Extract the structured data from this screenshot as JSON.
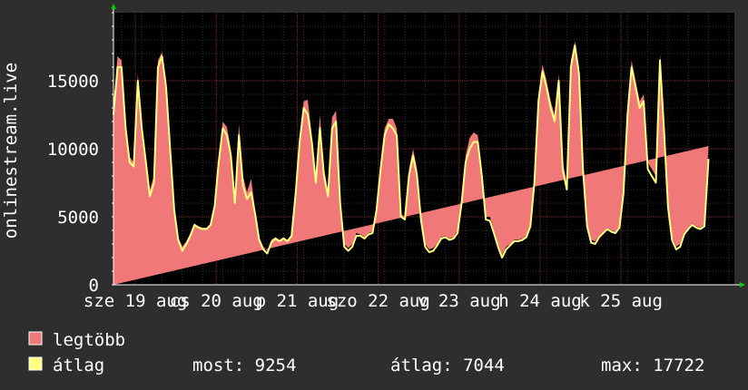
{
  "chart_data": {
    "type": "area",
    "ylabel": "onlinestream.live",
    "ylim": [
      0,
      20000
    ],
    "yticks": [
      {
        "value": 0,
        "label": "0"
      },
      {
        "value": 5000,
        "label": "5000"
      },
      {
        "value": 10000,
        "label": "10000"
      },
      {
        "value": 15000,
        "label": "15000"
      }
    ],
    "xlim": [
      0,
      7.67
    ],
    "xticks": [
      {
        "value": 0.27,
        "label": "sze 19 aug"
      },
      {
        "value": 1.27,
        "label": "cs 20 aug"
      },
      {
        "value": 2.27,
        "label": "p 21 aug"
      },
      {
        "value": 3.27,
        "label": "szo 22 aug"
      },
      {
        "value": 4.27,
        "label": "v 23 aug"
      },
      {
        "value": 5.27,
        "label": "h 24 aug"
      },
      {
        "value": 6.27,
        "label": "k 25 aug"
      }
    ],
    "grid": true,
    "colors": {
      "background": "#2e2e2e",
      "canvas": "#000000",
      "grid_minor": "#333333",
      "grid_major": "#8a2a2a",
      "max_fill": "#f07878",
      "avg_line": "#ffff80",
      "arrow": "#00cc00"
    },
    "x": [
      0,
      0.05,
      0.1,
      0.15,
      0.2,
      0.25,
      0.3,
      0.35,
      0.4,
      0.45,
      0.5,
      0.55,
      0.6,
      0.65,
      0.7,
      0.75,
      0.8,
      0.85,
      0.9,
      0.95,
      1.0,
      1.05,
      1.1,
      1.15,
      1.2,
      1.25,
      1.3,
      1.35,
      1.4,
      1.45,
      1.5,
      1.55,
      1.6,
      1.65,
      1.7,
      1.75,
      1.8,
      1.85,
      1.9,
      1.95,
      2.0,
      2.05,
      2.1,
      2.15,
      2.2,
      2.25,
      2.3,
      2.35,
      2.4,
      2.45,
      2.5,
      2.55,
      2.6,
      2.65,
      2.7,
      2.75,
      2.8,
      2.85,
      2.9,
      2.95,
      3.0,
      3.05,
      3.1,
      3.15,
      3.2,
      3.25,
      3.3,
      3.35,
      3.4,
      3.45,
      3.5,
      3.55,
      3.6,
      3.65,
      3.7,
      3.75,
      3.8,
      3.85,
      3.9,
      3.95,
      4.0,
      4.05,
      4.1,
      4.15,
      4.2,
      4.25,
      4.3,
      4.35,
      4.4,
      4.45,
      4.5,
      4.55,
      4.6,
      4.65,
      4.7,
      4.75,
      4.8,
      4.85,
      4.9,
      4.95,
      5.0,
      5.05,
      5.1,
      5.15,
      5.2,
      5.25,
      5.3,
      5.35,
      5.4,
      5.45,
      5.5,
      5.55,
      5.6,
      5.65,
      5.7,
      5.75,
      5.8,
      5.85,
      5.9,
      5.95,
      6.0,
      6.05,
      6.1,
      6.15,
      6.2,
      6.25,
      6.3,
      6.35,
      6.4,
      6.45,
      6.5,
      6.55,
      6.6,
      6.65,
      6.7,
      6.75,
      6.8,
      6.85,
      6.9,
      6.95,
      7.0,
      7.05,
      7.1,
      7.15,
      7.2,
      7.25,
      7.3,
      7.35,
      7.4,
      7.45,
      7.5,
      7.55,
      7.6,
      7.65
    ],
    "series": [
      {
        "name": "legtöbb",
        "color": "#f07878",
        "values": [
          13200,
          16800,
          16500,
          12000,
          9400,
          9000,
          15500,
          12000,
          9500,
          7000,
          8000,
          16500,
          17100,
          15000,
          10500,
          5800,
          3500,
          2800,
          3200,
          3800,
          4500,
          4300,
          4200,
          4200,
          4500,
          6000,
          9500,
          12000,
          11600,
          10000,
          6500,
          11800,
          8000,
          6800,
          7800,
          5500,
          3500,
          2800,
          2500,
          3300,
          3500,
          3300,
          3500,
          3300,
          3700,
          7000,
          11000,
          13500,
          13600,
          11000,
          8000,
          12500,
          8500,
          7000,
          12300,
          12800,
          6500,
          3000,
          2700,
          3000,
          3800,
          3700,
          3500,
          3800,
          3900,
          5800,
          9000,
          11500,
          12200,
          12200,
          11500,
          5200,
          5000,
          8500,
          10000,
          8500,
          5000,
          3000,
          2600,
          2700,
          3000,
          3500,
          3600,
          3400,
          3500,
          4000,
          6500,
          9500,
          10800,
          11200,
          11000,
          8500,
          5000,
          5000,
          4000,
          3000,
          2200,
          2800,
          3000,
          3300,
          3300,
          3400,
          3600,
          4500,
          8000,
          14000,
          16200,
          15000,
          13500,
          12500,
          15500,
          9000,
          7500,
          16500,
          17900,
          16000,
          9000,
          4500,
          3300,
          3200,
          3600,
          3900,
          4200,
          4000,
          3900,
          4300,
          7000,
          13000,
          16500,
          15000,
          13500,
          14000,
          9000,
          8500,
          8000,
          17000,
          12000,
          6000,
          3500,
          2800,
          3000,
          3800,
          4200,
          4500,
          4300,
          4200,
          4400,
          10200
        ]
      },
      {
        "name": "átlag",
        "color": "#ffff80",
        "values": [
          12500,
          16000,
          16000,
          11500,
          9000,
          8700,
          15000,
          11500,
          9000,
          6500,
          7500,
          16000,
          16800,
          14500,
          10000,
          5500,
          3300,
          2500,
          3000,
          3600,
          4400,
          4200,
          4100,
          4100,
          4400,
          5800,
          9000,
          11500,
          11000,
          9500,
          6000,
          11000,
          7300,
          6300,
          6800,
          5200,
          3300,
          2600,
          2300,
          3100,
          3400,
          3200,
          3400,
          3200,
          3600,
          6700,
          10500,
          13000,
          12500,
          10500,
          7500,
          11500,
          8000,
          6500,
          11500,
          12000,
          6000,
          2800,
          2500,
          2800,
          3600,
          3600,
          3400,
          3700,
          3800,
          5500,
          8500,
          11000,
          11800,
          11500,
          11000,
          5000,
          4800,
          8000,
          9500,
          8000,
          4700,
          2800,
          2400,
          2500,
          2900,
          3400,
          3500,
          3300,
          3400,
          3800,
          6000,
          9000,
          10000,
          10500,
          10500,
          8000,
          4800,
          4700,
          3800,
          2800,
          2000,
          2600,
          2900,
          3200,
          3200,
          3300,
          3500,
          4300,
          7500,
          13500,
          15700,
          14500,
          13000,
          12000,
          15000,
          8500,
          7000,
          16000,
          17600,
          15500,
          8500,
          4300,
          3100,
          3000,
          3500,
          3800,
          4100,
          3900,
          3800,
          4200,
          6700,
          12500,
          16000,
          14500,
          13000,
          13500,
          8500,
          8000,
          7500,
          16500,
          11500,
          5700,
          3300,
          2600,
          2800,
          3700,
          4100,
          4400,
          4200,
          4100,
          4300,
          9254
        ]
      }
    ]
  },
  "legend": {
    "max_label": "legtöbb",
    "avg_label": "átlag"
  },
  "stats": {
    "current": "most: 9254",
    "average": "átlag: 7044",
    "max": "max: 17722"
  }
}
